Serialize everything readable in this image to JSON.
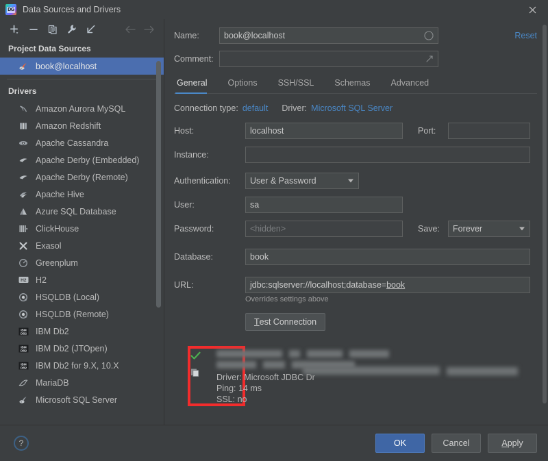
{
  "window": {
    "title": "Data Sources and Drivers",
    "logo_text": "DG",
    "close_icon": "close-icon"
  },
  "toolbar": {
    "items": [
      {
        "name": "add-data-source-button",
        "icon": "plus-icon"
      },
      {
        "name": "remove-data-source-button",
        "icon": "minus-icon"
      },
      {
        "name": "duplicate-data-source-button",
        "icon": "copy-icon"
      },
      {
        "name": "driver-properties-button",
        "icon": "wrench-icon"
      },
      {
        "name": "import-data-source-button",
        "icon": "import-arrow-icon"
      },
      {
        "name": "navigate-back-button",
        "icon": "arrow-left-icon"
      },
      {
        "name": "navigate-forward-button",
        "icon": "arrow-right-icon"
      }
    ]
  },
  "sidebar": {
    "project_sources_label": "Project Data Sources",
    "project_sources": [
      {
        "label": "book@localhost",
        "icon": "sqlserver-icon",
        "selected": true
      }
    ],
    "drivers_label": "Drivers",
    "drivers": [
      {
        "label": "Amazon Aurora MySQL",
        "icon": "aurora-icon"
      },
      {
        "label": "Amazon Redshift",
        "icon": "redshift-icon"
      },
      {
        "label": "Apache Cassandra",
        "icon": "cassandra-icon"
      },
      {
        "label": "Apache Derby (Embedded)",
        "icon": "derby-icon"
      },
      {
        "label": "Apache Derby (Remote)",
        "icon": "derby-icon"
      },
      {
        "label": "Apache Hive",
        "icon": "hive-icon"
      },
      {
        "label": "Azure SQL Database",
        "icon": "azure-icon"
      },
      {
        "label": "ClickHouse",
        "icon": "clickhouse-icon"
      },
      {
        "label": "Exasol",
        "icon": "exasol-icon"
      },
      {
        "label": "Greenplum",
        "icon": "greenplum-icon"
      },
      {
        "label": "H2",
        "icon": "h2-icon"
      },
      {
        "label": "HSQLDB (Local)",
        "icon": "hsqldb-icon"
      },
      {
        "label": "HSQLDB (Remote)",
        "icon": "hsqldb-icon"
      },
      {
        "label": "IBM Db2",
        "icon": "db2-icon"
      },
      {
        "label": "IBM Db2 (JTOpen)",
        "icon": "db2-icon"
      },
      {
        "label": "IBM Db2 for 9.X, 10.X",
        "icon": "db2-icon"
      },
      {
        "label": "MariaDB",
        "icon": "mariadb-icon"
      },
      {
        "label": "Microsoft SQL Server",
        "icon": "sqlserver-icon"
      }
    ]
  },
  "header": {
    "name_label": "Name:",
    "name_value": "book@localhost",
    "comment_label": "Comment:",
    "comment_value": "",
    "reset_label": "Reset"
  },
  "tabs": [
    {
      "label": "General",
      "active": true
    },
    {
      "label": "Options",
      "active": false
    },
    {
      "label": "SSH/SSL",
      "active": false
    },
    {
      "label": "Schemas",
      "active": false
    },
    {
      "label": "Advanced",
      "active": false
    }
  ],
  "connection": {
    "type_label": "Connection type:",
    "type_value": "default",
    "driver_label": "Driver:",
    "driver_value": "Microsoft SQL Server"
  },
  "form": {
    "host_label": "Host:",
    "host_value": "localhost",
    "port_label": "Port:",
    "port_value": "",
    "instance_label": "Instance:",
    "instance_value": "",
    "auth_label": "Authentication:",
    "auth_value": "User & Password",
    "user_label": "User:",
    "user_value": "sa",
    "password_label": "Password:",
    "password_placeholder": "<hidden>",
    "save_label": "Save:",
    "save_value": "Forever",
    "database_label": "Database:",
    "database_value": "book",
    "url_label": "URL:",
    "url_value_prefix": "jdbc:sqlserver://localhost;database=",
    "url_value_underlined": "book",
    "url_hint": "Overrides settings above"
  },
  "test": {
    "button_label_accel": "T",
    "button_label_rest": "est Connection",
    "status_icon": "green-check-icon",
    "copy_icon": "copy-result-icon",
    "driver_line": "Driver: Microsoft JDBC Dr",
    "ping_line": "Ping: 14 ms",
    "ssl_line": "SSL: no"
  },
  "footer": {
    "help_label": "?",
    "ok_label": "OK",
    "cancel_label": "Cancel",
    "apply_accel": "A",
    "apply_rest": "pply"
  },
  "colors": {
    "accent_blue": "#4a88c7",
    "selection_blue": "#4b6eaf",
    "primary_button": "#3f66a5",
    "highlight_red": "#f22c2c",
    "success_green": "#4caf50",
    "background": "#3c3f41"
  }
}
